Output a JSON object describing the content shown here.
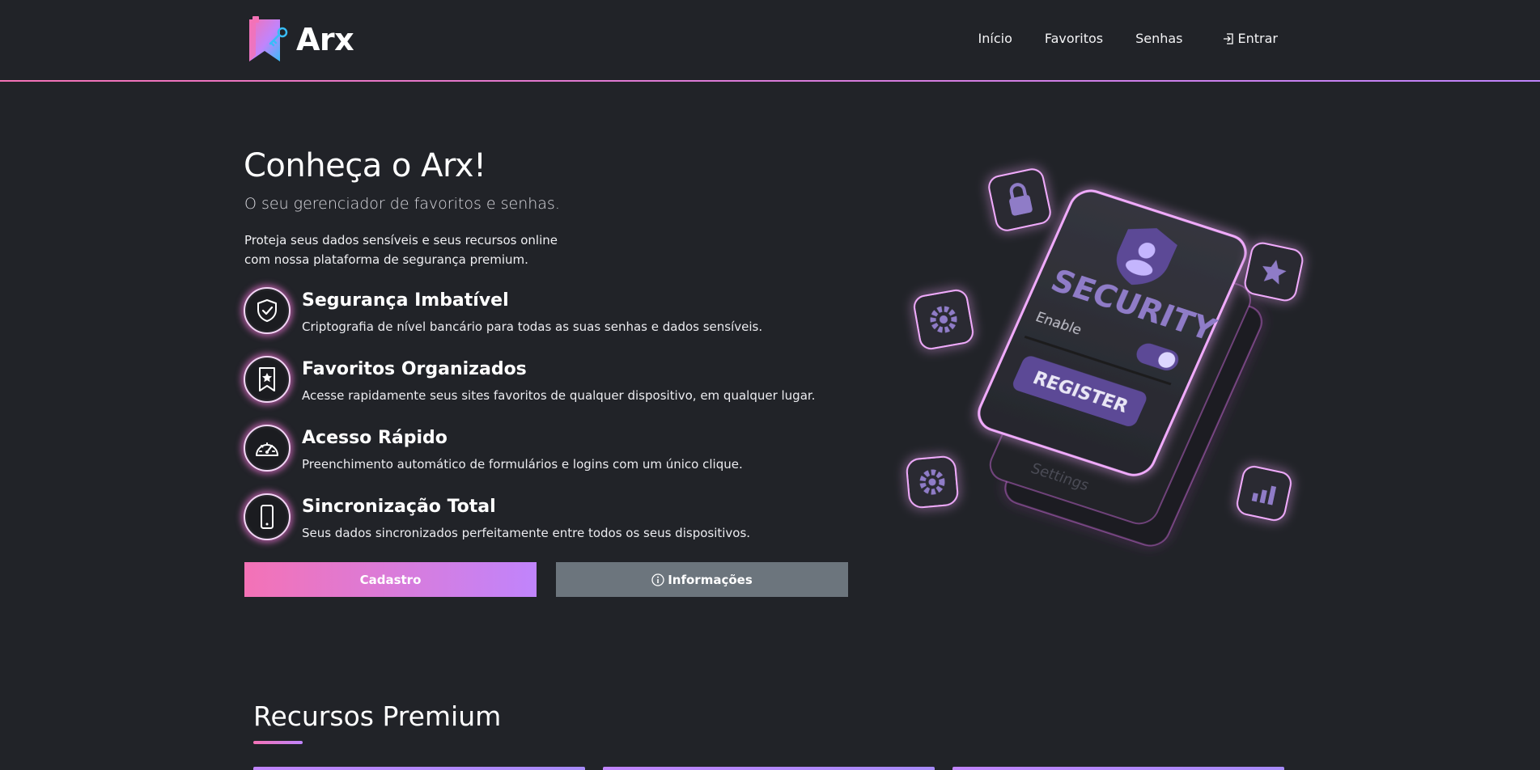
{
  "navbar": {
    "brand_name": "Arx",
    "links": [
      {
        "label": "Início",
        "icon": ""
      },
      {
        "label": "Favoritos",
        "icon": ""
      },
      {
        "label": "Senhas",
        "icon": ""
      },
      {
        "label": "Entrar",
        "icon": "login-icon"
      }
    ]
  },
  "hero": {
    "title": "Conheça o Arx!",
    "subtitle": "O seu gerenciador de favoritos e senhas.",
    "description_line1": "Proteja seus dados sensíveis e seus recursos online",
    "description_line2": "com nossa plataforma de segurança premium.",
    "features": [
      {
        "icon": "shield-check-icon",
        "title": "Segurança Imbatível",
        "text": "Criptografia de nível bancário para todas as suas senhas e dados sensíveis."
      },
      {
        "icon": "bookmark-star-icon",
        "title": "Favoritos Organizados",
        "text": "Acesse rapidamente seus sites favoritos de qualquer dispositivo, em qualquer lugar."
      },
      {
        "icon": "speedometer-icon",
        "title": "Acesso Rápido",
        "text": "Preenchimento automático de formulários e logins com um único clique."
      },
      {
        "icon": "phone-icon",
        "title": "Sincronização Total",
        "text": "Seus dados sincronizados perfeitamente entre todos os seus dispositivos."
      }
    ],
    "primary_button": "Cadastro",
    "secondary_button": "Informações"
  },
  "illustration": {
    "card_heading": "SECURITY",
    "toggle_label": "Enable",
    "register_label": "REGISTER",
    "settings_label": "Settings"
  },
  "section": {
    "title": "Recursos Premium"
  },
  "colors": {
    "background": "#212328",
    "accent_start": "#f472b6",
    "accent_end": "#c084fc",
    "secondary_button": "#6c757d",
    "glow": "#ec72d3"
  }
}
